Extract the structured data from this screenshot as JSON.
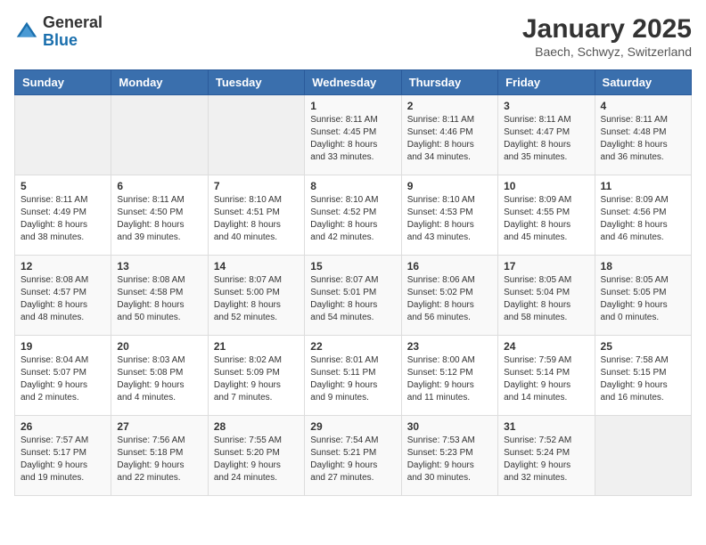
{
  "logo": {
    "general": "General",
    "blue": "Blue"
  },
  "title": "January 2025",
  "subtitle": "Baech, Schwyz, Switzerland",
  "days_of_week": [
    "Sunday",
    "Monday",
    "Tuesday",
    "Wednesday",
    "Thursday",
    "Friday",
    "Saturday"
  ],
  "weeks": [
    [
      {
        "day": "",
        "info": ""
      },
      {
        "day": "",
        "info": ""
      },
      {
        "day": "",
        "info": ""
      },
      {
        "day": "1",
        "info": "Sunrise: 8:11 AM\nSunset: 4:45 PM\nDaylight: 8 hours\nand 33 minutes."
      },
      {
        "day": "2",
        "info": "Sunrise: 8:11 AM\nSunset: 4:46 PM\nDaylight: 8 hours\nand 34 minutes."
      },
      {
        "day": "3",
        "info": "Sunrise: 8:11 AM\nSunset: 4:47 PM\nDaylight: 8 hours\nand 35 minutes."
      },
      {
        "day": "4",
        "info": "Sunrise: 8:11 AM\nSunset: 4:48 PM\nDaylight: 8 hours\nand 36 minutes."
      }
    ],
    [
      {
        "day": "5",
        "info": "Sunrise: 8:11 AM\nSunset: 4:49 PM\nDaylight: 8 hours\nand 38 minutes."
      },
      {
        "day": "6",
        "info": "Sunrise: 8:11 AM\nSunset: 4:50 PM\nDaylight: 8 hours\nand 39 minutes."
      },
      {
        "day": "7",
        "info": "Sunrise: 8:10 AM\nSunset: 4:51 PM\nDaylight: 8 hours\nand 40 minutes."
      },
      {
        "day": "8",
        "info": "Sunrise: 8:10 AM\nSunset: 4:52 PM\nDaylight: 8 hours\nand 42 minutes."
      },
      {
        "day": "9",
        "info": "Sunrise: 8:10 AM\nSunset: 4:53 PM\nDaylight: 8 hours\nand 43 minutes."
      },
      {
        "day": "10",
        "info": "Sunrise: 8:09 AM\nSunset: 4:55 PM\nDaylight: 8 hours\nand 45 minutes."
      },
      {
        "day": "11",
        "info": "Sunrise: 8:09 AM\nSunset: 4:56 PM\nDaylight: 8 hours\nand 46 minutes."
      }
    ],
    [
      {
        "day": "12",
        "info": "Sunrise: 8:08 AM\nSunset: 4:57 PM\nDaylight: 8 hours\nand 48 minutes."
      },
      {
        "day": "13",
        "info": "Sunrise: 8:08 AM\nSunset: 4:58 PM\nDaylight: 8 hours\nand 50 minutes."
      },
      {
        "day": "14",
        "info": "Sunrise: 8:07 AM\nSunset: 5:00 PM\nDaylight: 8 hours\nand 52 minutes."
      },
      {
        "day": "15",
        "info": "Sunrise: 8:07 AM\nSunset: 5:01 PM\nDaylight: 8 hours\nand 54 minutes."
      },
      {
        "day": "16",
        "info": "Sunrise: 8:06 AM\nSunset: 5:02 PM\nDaylight: 8 hours\nand 56 minutes."
      },
      {
        "day": "17",
        "info": "Sunrise: 8:05 AM\nSunset: 5:04 PM\nDaylight: 8 hours\nand 58 minutes."
      },
      {
        "day": "18",
        "info": "Sunrise: 8:05 AM\nSunset: 5:05 PM\nDaylight: 9 hours\nand 0 minutes."
      }
    ],
    [
      {
        "day": "19",
        "info": "Sunrise: 8:04 AM\nSunset: 5:07 PM\nDaylight: 9 hours\nand 2 minutes."
      },
      {
        "day": "20",
        "info": "Sunrise: 8:03 AM\nSunset: 5:08 PM\nDaylight: 9 hours\nand 4 minutes."
      },
      {
        "day": "21",
        "info": "Sunrise: 8:02 AM\nSunset: 5:09 PM\nDaylight: 9 hours\nand 7 minutes."
      },
      {
        "day": "22",
        "info": "Sunrise: 8:01 AM\nSunset: 5:11 PM\nDaylight: 9 hours\nand 9 minutes."
      },
      {
        "day": "23",
        "info": "Sunrise: 8:00 AM\nSunset: 5:12 PM\nDaylight: 9 hours\nand 11 minutes."
      },
      {
        "day": "24",
        "info": "Sunrise: 7:59 AM\nSunset: 5:14 PM\nDaylight: 9 hours\nand 14 minutes."
      },
      {
        "day": "25",
        "info": "Sunrise: 7:58 AM\nSunset: 5:15 PM\nDaylight: 9 hours\nand 16 minutes."
      }
    ],
    [
      {
        "day": "26",
        "info": "Sunrise: 7:57 AM\nSunset: 5:17 PM\nDaylight: 9 hours\nand 19 minutes."
      },
      {
        "day": "27",
        "info": "Sunrise: 7:56 AM\nSunset: 5:18 PM\nDaylight: 9 hours\nand 22 minutes."
      },
      {
        "day": "28",
        "info": "Sunrise: 7:55 AM\nSunset: 5:20 PM\nDaylight: 9 hours\nand 24 minutes."
      },
      {
        "day": "29",
        "info": "Sunrise: 7:54 AM\nSunset: 5:21 PM\nDaylight: 9 hours\nand 27 minutes."
      },
      {
        "day": "30",
        "info": "Sunrise: 7:53 AM\nSunset: 5:23 PM\nDaylight: 9 hours\nand 30 minutes."
      },
      {
        "day": "31",
        "info": "Sunrise: 7:52 AM\nSunset: 5:24 PM\nDaylight: 9 hours\nand 32 minutes."
      },
      {
        "day": "",
        "info": ""
      }
    ]
  ]
}
